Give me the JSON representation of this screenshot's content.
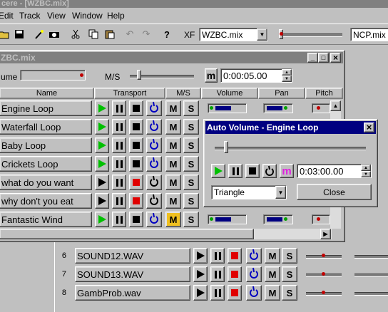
{
  "app": {
    "title": "Cakewalk Pro Audio Fanfare - [WZBC.mix]",
    "title_visible": "cere - [WZBC.mix]",
    "menu": [
      "Edit",
      "Track",
      "View",
      "Window",
      "Help"
    ]
  },
  "toolbar": {
    "xf_label": "XF",
    "xf_file": "WZBC.mix",
    "right_file": "NCP.mix"
  },
  "mix_window": {
    "title": "ZBC.mix",
    "volume_label": "ume",
    "ms_label": "M/S",
    "m_label": "m",
    "time": "0:00:05.00",
    "headers": {
      "name": "Name",
      "transport": "Transport",
      "ms": "M/S",
      "volume": "Volume",
      "pan": "Pan",
      "pitch": "Pitch"
    },
    "rows": [
      {
        "name": "Engine Loop",
        "play_color": "green",
        "stop_color": "black",
        "m_active": false
      },
      {
        "name": "Waterfall Loop",
        "play_color": "green",
        "stop_color": "black",
        "m_active": false
      },
      {
        "name": "Baby Loop",
        "play_color": "green",
        "stop_color": "black",
        "m_active": false
      },
      {
        "name": "Crickets Loop",
        "play_color": "green",
        "stop_color": "black",
        "m_active": false
      },
      {
        "name": "what do you want",
        "play_color": "black",
        "stop_color": "red",
        "m_active": false
      },
      {
        "name": "why don't you eat",
        "play_color": "black",
        "stop_color": "red",
        "m_active": false
      },
      {
        "name": "Fantastic Wind",
        "play_color": "green",
        "stop_color": "black",
        "m_active": true
      }
    ],
    "m_text": "M",
    "s_text": "S"
  },
  "back_window": {
    "rows": [
      {
        "num": "6",
        "name": "SOUND12.WAV"
      },
      {
        "num": "7",
        "name": "SOUND13.WAV"
      },
      {
        "num": "8",
        "name": "GambProb.wav"
      }
    ],
    "m_text": "M",
    "s_text": "S"
  },
  "auto_volume": {
    "title": "Auto Volume - Engine Loop",
    "close_x": "×",
    "m_label": "m",
    "time": "0:03:00.00",
    "shape": "Triangle",
    "close_button": "Close",
    "slider_level": 0.06
  },
  "colors": {
    "titlebar_active": "#000080",
    "titlebar_inactive": "#808080",
    "play_green": "#00c000",
    "stop_red": "#e00000",
    "m_active": "#f0c020",
    "m_pink": "#e020e0",
    "volume_blue": "#0000a0"
  }
}
